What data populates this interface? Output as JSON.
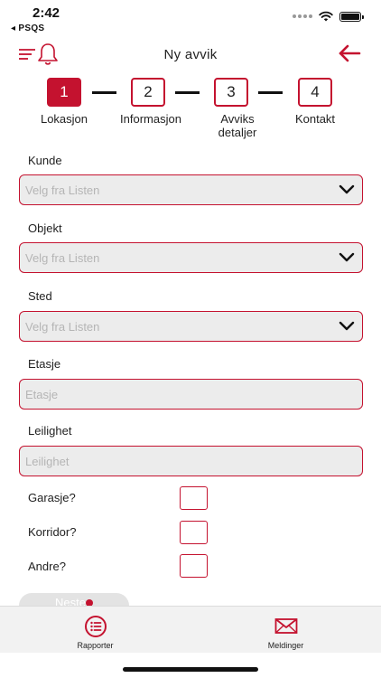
{
  "status_bar": {
    "time": "2:42",
    "back_app": "◂ PSQS"
  },
  "header": {
    "title": "Ny avvik"
  },
  "stepper": {
    "steps": [
      {
        "number": "1",
        "label": "Lokasjon"
      },
      {
        "number": "2",
        "label": "Informasjon"
      },
      {
        "number": "3",
        "label": "Avviks detaljer"
      },
      {
        "number": "4",
        "label": "Kontakt"
      }
    ],
    "active_step": 1
  },
  "form": {
    "kunde": {
      "label": "Kunde",
      "placeholder": "Velg fra Listen"
    },
    "objekt": {
      "label": "Objekt",
      "placeholder": "Velg fra Listen"
    },
    "sted": {
      "label": "Sted",
      "placeholder": "Velg fra Listen"
    },
    "etasje": {
      "label": "Etasje",
      "placeholder": "Etasje",
      "value": ""
    },
    "leilighet": {
      "label": "Leilighet",
      "placeholder": "Leilighet",
      "value": ""
    },
    "checkboxes": [
      {
        "label": "Garasje?",
        "checked": false
      },
      {
        "label": "Korridor?",
        "checked": false
      },
      {
        "label": "Andre?",
        "checked": false
      }
    ],
    "next_label": "Neste"
  },
  "tab_bar": {
    "tabs": [
      {
        "label": "Rapporter",
        "icon": "list-icon"
      },
      {
        "label": "Meldinger",
        "icon": "envelope-icon"
      }
    ]
  },
  "colors": {
    "accent": "#c4122f",
    "input_bg": "#ececec",
    "tab_bg": "#f2f2f2"
  }
}
